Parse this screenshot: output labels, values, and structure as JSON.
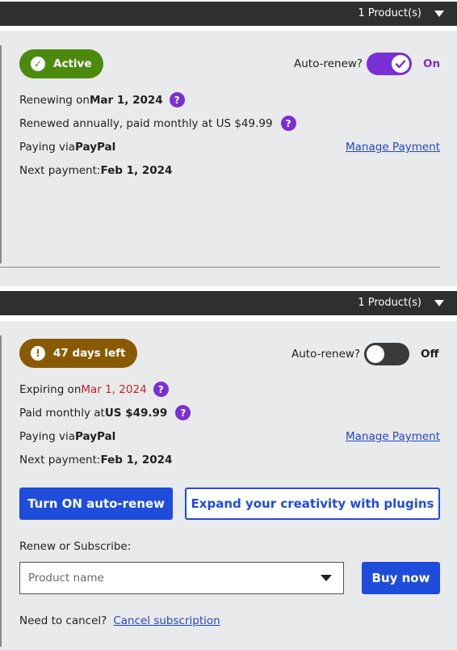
{
  "colors": {
    "active_green": "#4c8a0e",
    "warning_brown": "#8a5a00",
    "toggle_on": "#7a2fd6",
    "toggle_off": "#3a3a3a",
    "accent_blue": "#1f4ddb",
    "expiry_red": "#c4202b",
    "help_purple": "#7a2fd6"
  },
  "subscriptions": [
    {
      "products_label": "1 Product(s)",
      "status_label": "Active",
      "status_icon": "check-circle-icon",
      "auto_renew_label": "Auto-renew?",
      "auto_renew_on": true,
      "auto_renew_state": "On",
      "renew_prefix": "Renewing on ",
      "renew_date": "Mar 1, 2024",
      "billing_text": "Renewed annually, paid monthly at US $49.99",
      "paying_prefix": "Paying via ",
      "paying_method": "PayPal",
      "manage_payment": "Manage Payment",
      "next_payment_prefix": "Next payment: ",
      "next_payment_date": "Feb 1, 2024"
    },
    {
      "products_label": "1 Product(s)",
      "status_label": "47 days left",
      "status_icon": "exclamation-circle-icon",
      "auto_renew_label": "Auto-renew?",
      "auto_renew_on": false,
      "auto_renew_state": "Off",
      "expire_prefix": "Expiring on ",
      "expire_date": "Mar 1, 2024",
      "billing_prefix": "Paid monthly at ",
      "billing_price": "US $49.99",
      "paying_prefix": "Paying via ",
      "paying_method": "PayPal",
      "manage_payment": "Manage Payment",
      "next_payment_prefix": "Next payment: ",
      "next_payment_date": "Feb 1, 2024",
      "turn_on_button": "Turn ON auto-renew",
      "plugins_button": "Expand your creativity with plugins",
      "renew_label": "Renew or Subscribe:",
      "product_placeholder": "Product name",
      "buy_button": "Buy now",
      "cancel_prefix": "Need to cancel?",
      "cancel_link": "Cancel subscription"
    }
  ]
}
